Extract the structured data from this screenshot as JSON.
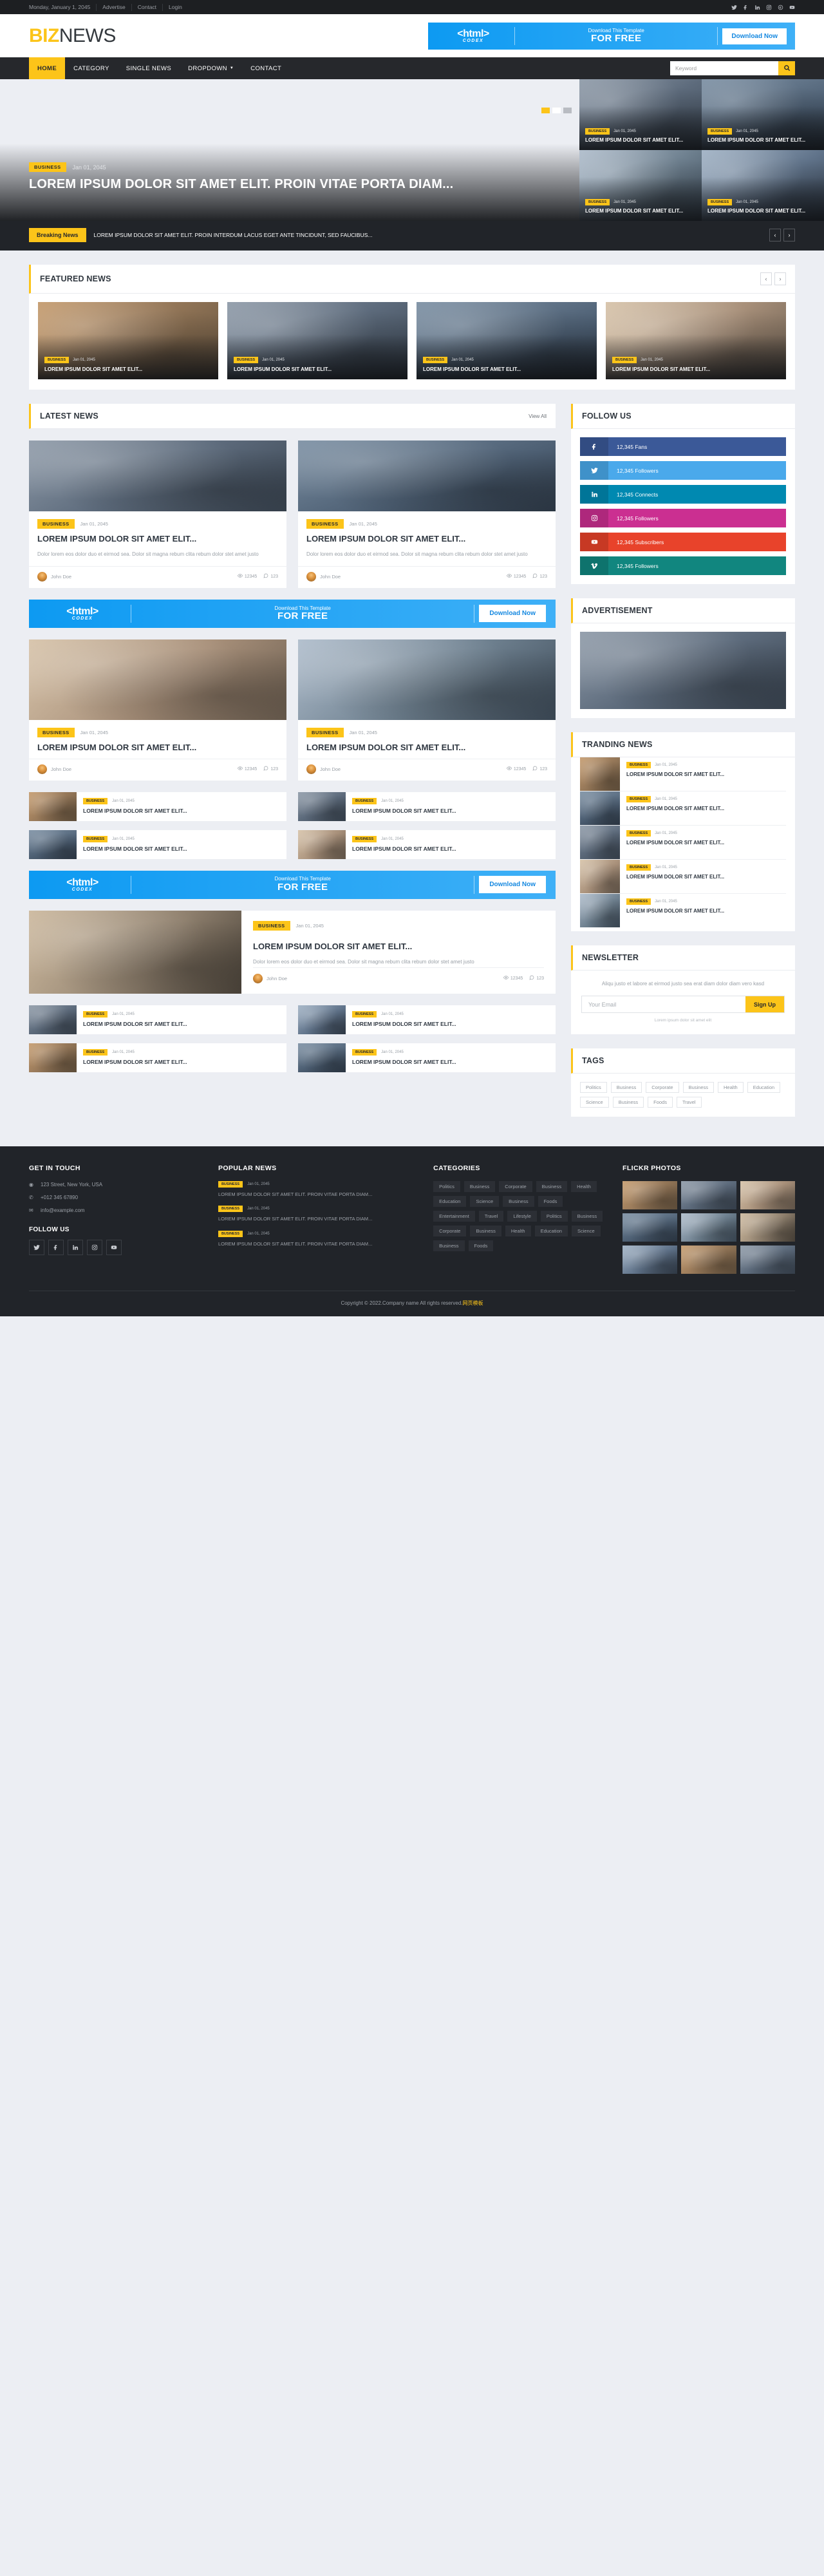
{
  "topbar": {
    "date": "Monday, January 1, 2045",
    "links": [
      "Advertise",
      "Contact",
      "Login"
    ],
    "social": [
      "twitter-icon",
      "facebook-icon",
      "linkedin-icon",
      "instagram-icon",
      "google-plus-icon",
      "youtube-icon"
    ]
  },
  "header": {
    "logo_first": "BIZ",
    "logo_second": "NEWS",
    "promo": {
      "brand": "<html>",
      "brand_sub": "CODEX",
      "line1": "Download This Template",
      "line2": "FOR FREE",
      "button": "Download Now"
    }
  },
  "nav": {
    "items": [
      {
        "label": "HOME",
        "active": true,
        "caret": false
      },
      {
        "label": "CATEGORY",
        "active": false,
        "caret": false
      },
      {
        "label": "SINGLE NEWS",
        "active": false,
        "caret": false
      },
      {
        "label": "DROPDOWN",
        "active": false,
        "caret": true
      },
      {
        "label": "CONTACT",
        "active": false,
        "caret": false
      }
    ],
    "search_placeholder": "Keyword",
    "search_value": ""
  },
  "hero": {
    "badge": "BUSINESS",
    "date": "Jan 01, 2045",
    "title": "LOREM IPSUM DOLOR SIT AMET ELIT. PROIN VITAE PORTA DIAM...",
    "side": [
      {
        "badge": "BUSINESS",
        "date": "Jan 01, 2045",
        "title": "LOREM IPSUM DOLOR SIT AMET ELIT...",
        "img": "ph-b"
      },
      {
        "badge": "BUSINESS",
        "date": "Jan 01, 2045",
        "title": "LOREM IPSUM DOLOR SIT AMET ELIT...",
        "img": "ph-d"
      },
      {
        "badge": "BUSINESS",
        "date": "Jan 01, 2045",
        "title": "LOREM IPSUM DOLOR SIT AMET ELIT...",
        "img": "ph-f"
      },
      {
        "badge": "BUSINESS",
        "date": "Jan 01, 2045",
        "title": "LOREM IPSUM DOLOR SIT AMET ELIT...",
        "img": "ph-h"
      }
    ]
  },
  "breaking": {
    "label": "Breaking News",
    "text": "LOREM IPSUM DOLOR SIT AMET ELIT. PROIN INTERDUM LACUS EGET ANTE TINCIDUNT, SED FAUCIBUS...",
    "prev": "‹",
    "next": "›"
  },
  "featured": {
    "title": "FEATURED NEWS",
    "prev": "‹",
    "next": "›",
    "cards": [
      {
        "badge": "BUSINESS",
        "date": "Jan 01, 2045",
        "title": "LOREM IPSUM DOLOR SIT AMET ELIT...",
        "img": "ph-a"
      },
      {
        "badge": "BUSINESS",
        "date": "Jan 01, 2045",
        "title": "LOREM IPSUM DOLOR SIT AMET ELIT...",
        "img": "ph-b"
      },
      {
        "badge": "BUSINESS",
        "date": "Jan 01, 2045",
        "title": "LOREM IPSUM DOLOR SIT AMET ELIT...",
        "img": "ph-d"
      },
      {
        "badge": "BUSINESS",
        "date": "Jan 01, 2045",
        "title": "LOREM IPSUM DOLOR SIT AMET ELIT...",
        "img": "ph-c"
      }
    ]
  },
  "latest": {
    "title": "LATEST NEWS",
    "view_all": "View All",
    "cards": [
      {
        "badge": "BUSINESS",
        "date": "Jan 01, 2045",
        "title": "LOREM IPSUM DOLOR SIT AMET ELIT...",
        "desc": "Dolor lorem eos dolor duo et eirmod sea. Dolor sit magna rebum clita rebum dolor stet amet justo",
        "author": "John Doe",
        "views": "12345",
        "comments": "123",
        "img": "ph-b"
      },
      {
        "badge": "BUSINESS",
        "date": "Jan 01, 2045",
        "title": "LOREM IPSUM DOLOR SIT AMET ELIT...",
        "desc": "Dolor lorem eos dolor duo et eirmod sea. Dolor sit magna rebum clita rebum dolor stet amet justo",
        "author": "John Doe",
        "views": "12345",
        "comments": "123",
        "img": "ph-d"
      },
      {
        "badge": "BUSINESS",
        "date": "Jan 01, 2045",
        "title": "LOREM IPSUM DOLOR SIT AMET ELIT...",
        "desc": "",
        "author": "John Doe",
        "views": "12345",
        "comments": "123",
        "img": "ph-c"
      },
      {
        "badge": "BUSINESS",
        "date": "Jan 01, 2045",
        "title": "LOREM IPSUM DOLOR SIT AMET ELIT...",
        "desc": "",
        "author": "John Doe",
        "views": "12345",
        "comments": "123",
        "img": "ph-f"
      }
    ],
    "mini": [
      {
        "badge": "BUSINESS",
        "date": "Jan 01, 2045",
        "title": "LOREM IPSUM DOLOR SIT AMET ELIT...",
        "img": "ph-a"
      },
      {
        "badge": "BUSINESS",
        "date": "Jan 01, 2045",
        "title": "LOREM IPSUM DOLOR SIT AMET ELIT...",
        "img": "ph-b"
      },
      {
        "badge": "BUSINESS",
        "date": "Jan 01, 2045",
        "title": "LOREM IPSUM DOLOR SIT AMET ELIT...",
        "img": "ph-d"
      },
      {
        "badge": "BUSINESS",
        "date": "Jan 01, 2045",
        "title": "LOREM IPSUM DOLOR SIT AMET ELIT...",
        "img": "ph-c"
      }
    ],
    "big": {
      "badge": "BUSINESS",
      "date": "Jan 01, 2045",
      "title": "LOREM IPSUM DOLOR SIT AMET ELIT...",
      "desc": "Dolor lorem eos dolor duo et eirmod sea. Dolor sit magna rebum clita rebum dolor stet amet justo",
      "author": "John Doe",
      "views": "12345",
      "comments": "123",
      "img": "ph-g"
    },
    "mini2": [
      {
        "badge": "BUSINESS",
        "date": "Jan 01, 2045",
        "title": "LOREM IPSUM DOLOR SIT AMET ELIT...",
        "img": "ph-b"
      },
      {
        "badge": "BUSINESS",
        "date": "Jan 01, 2045",
        "title": "LOREM IPSUM DOLOR SIT AMET ELIT...",
        "img": "ph-h"
      },
      {
        "badge": "BUSINESS",
        "date": "Jan 01, 2045",
        "title": "LOREM IPSUM DOLOR SIT AMET ELIT...",
        "img": "ph-a"
      },
      {
        "badge": "BUSINESS",
        "date": "Jan 01, 2045",
        "title": "LOREM IPSUM DOLOR SIT AMET ELIT...",
        "img": "ph-d"
      }
    ]
  },
  "sidebar": {
    "follow": {
      "title": "FOLLOW US",
      "items": [
        {
          "icon": "facebook-icon",
          "label": "12,345 Fans",
          "color": "#3b5998",
          "icon_bg": "#324a80"
        },
        {
          "icon": "twitter-icon",
          "label": "12,345 Followers",
          "color": "#4aa9eb",
          "icon_bg": "#3f90c9"
        },
        {
          "icon": "linkedin-icon",
          "label": "12,345 Connects",
          "color": "#0089b1",
          "icon_bg": "#027495"
        },
        {
          "icon": "instagram-icon",
          "label": "12,345 Followers",
          "color": "#cb2f91",
          "icon_bg": "#ac287b"
        },
        {
          "icon": "youtube-icon",
          "label": "12,345 Subscribers",
          "color": "#e8432b",
          "icon_bg": "#c53923"
        },
        {
          "icon": "vimeo-icon",
          "label": "12,345 Followers",
          "color": "#11867f",
          "icon_bg": "#0d6f69"
        }
      ]
    },
    "ad": {
      "title": "ADVERTISEMENT"
    },
    "trending": {
      "title": "TRANDING NEWS",
      "items": [
        {
          "badge": "BUSINESS",
          "date": "Jan 01, 2045",
          "title": "LOREM IPSUM DOLOR SIT AMET ELIT...",
          "img": "ph-a"
        },
        {
          "badge": "BUSINESS",
          "date": "Jan 01, 2045",
          "title": "LOREM IPSUM DOLOR SIT AMET ELIT...",
          "img": "ph-d"
        },
        {
          "badge": "BUSINESS",
          "date": "Jan 01, 2045",
          "title": "LOREM IPSUM DOLOR SIT AMET ELIT...",
          "img": "ph-b"
        },
        {
          "badge": "BUSINESS",
          "date": "Jan 01, 2045",
          "title": "LOREM IPSUM DOLOR SIT AMET ELIT...",
          "img": "ph-c"
        },
        {
          "badge": "BUSINESS",
          "date": "Jan 01, 2045",
          "title": "LOREM IPSUM DOLOR SIT AMET ELIT...",
          "img": "ph-f"
        }
      ]
    },
    "newsletter": {
      "title": "NEWSLETTER",
      "desc": "Aliqu justo et labore at eirmod justo sea erat diam dolor diam vero kasd",
      "placeholder": "Your Email",
      "value": "",
      "button": "Sign Up",
      "note": "Lorem ipsum dolor sit amet elit"
    },
    "tags": {
      "title": "TAGS",
      "items": [
        "Politics",
        "Business",
        "Corporate",
        "Business",
        "Health",
        "Education",
        "Science",
        "Business",
        "Foods",
        "Travel"
      ]
    }
  },
  "footer": {
    "contact": {
      "title": "GET IN TOUCH",
      "address": "123 Street, New York, USA",
      "phone": "+012 345 67890",
      "email": "info@example.com",
      "follow_title": "FOLLOW US",
      "social": [
        "twitter-icon",
        "facebook-icon",
        "linkedin-icon",
        "instagram-icon",
        "youtube-icon"
      ]
    },
    "popular": {
      "title": "POPULAR NEWS",
      "items": [
        {
          "badge": "BUSINESS",
          "date": "Jan 01, 2045",
          "title": "LOREM IPSUM DOLOR SIT AMET ELIT. PROIN VITAE PORTA DIAM..."
        },
        {
          "badge": "BUSINESS",
          "date": "Jan 01, 2045",
          "title": "LOREM IPSUM DOLOR SIT AMET ELIT. PROIN VITAE PORTA DIAM..."
        },
        {
          "badge": "BUSINESS",
          "date": "Jan 01, 2045",
          "title": "LOREM IPSUM DOLOR SIT AMET ELIT. PROIN VITAE PORTA DIAM..."
        }
      ]
    },
    "categories": {
      "title": "CATEGORIES",
      "items": [
        "Politics",
        "Business",
        "Corporate",
        "Business",
        "Health",
        "Education",
        "Science",
        "Business",
        "Foods",
        "Entertainment",
        "Travel",
        "Lifestyle",
        "Politics",
        "Business",
        "Corporate",
        "Business",
        "Health",
        "Education",
        "Science",
        "Business",
        "Foods"
      ]
    },
    "flickr": {
      "title": "FLICKR PHOTOS",
      "cells": [
        "ph-a",
        "ph-b",
        "ph-c",
        "ph-d",
        "ph-f",
        "ph-g",
        "ph-h",
        "ph-a",
        "ph-b"
      ]
    },
    "copyright_pre": "Copyright © 2022.Company name All rights reserved.",
    "copyright_link": "网页模板"
  }
}
